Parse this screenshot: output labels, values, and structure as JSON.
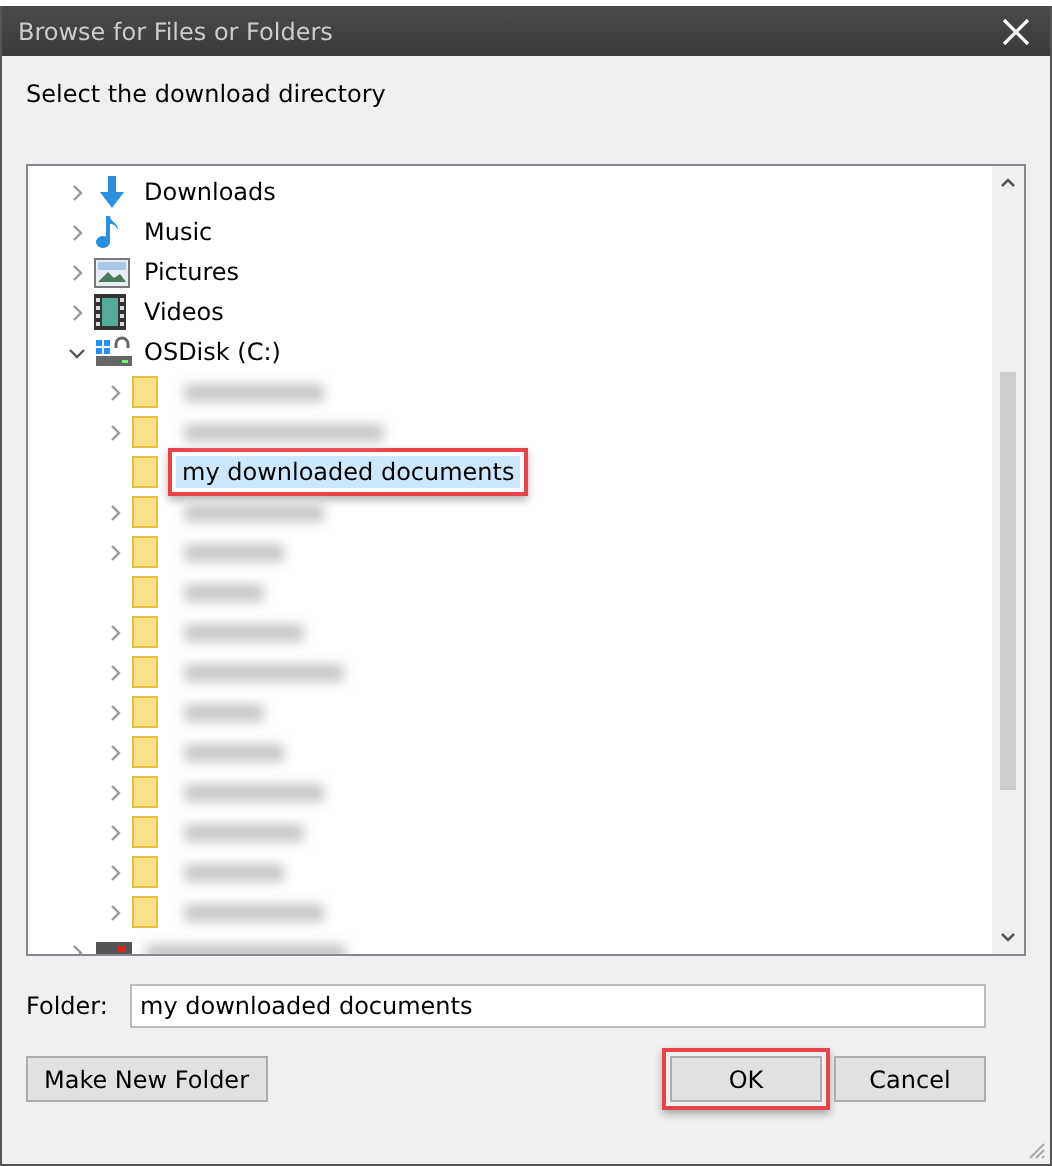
{
  "window": {
    "title": "Browse for Files or Folders"
  },
  "instruction": "Select the download directory",
  "tree": {
    "items": [
      {
        "label": "Downloads",
        "kind": "downloads",
        "expanded": false,
        "blurred": false,
        "selected": false,
        "annotated": false
      },
      {
        "label": "Music",
        "kind": "music",
        "expanded": false,
        "blurred": false,
        "selected": false,
        "annotated": false
      },
      {
        "label": "Pictures",
        "kind": "pictures",
        "expanded": false,
        "blurred": false,
        "selected": false,
        "annotated": false
      },
      {
        "label": "Videos",
        "kind": "videos",
        "expanded": false,
        "blurred": false,
        "selected": false,
        "annotated": false
      },
      {
        "label": "OSDisk (C:)",
        "kind": "drive",
        "expanded": true,
        "blurred": false,
        "selected": false,
        "annotated": false,
        "children": [
          {
            "kind": "folder",
            "expanded": false,
            "blurred": true,
            "selected": false,
            "annotated": false
          },
          {
            "kind": "folder",
            "expanded": false,
            "blurred": true,
            "selected": false,
            "annotated": false
          },
          {
            "label": "my downloaded documents",
            "kind": "folder",
            "blurred": false,
            "selected": true,
            "annotated": true
          },
          {
            "kind": "folder",
            "expanded": false,
            "blurred": true,
            "selected": false,
            "annotated": false
          },
          {
            "kind": "folder",
            "expanded": false,
            "blurred": true,
            "selected": false,
            "annotated": false
          },
          {
            "kind": "folder",
            "blurred": true,
            "selected": false,
            "annotated": false
          },
          {
            "kind": "folder",
            "expanded": false,
            "blurred": true,
            "selected": false,
            "annotated": false
          },
          {
            "kind": "folder",
            "expanded": false,
            "blurred": true,
            "selected": false,
            "annotated": false
          },
          {
            "kind": "folder",
            "expanded": false,
            "blurred": true,
            "selected": false,
            "annotated": false
          },
          {
            "kind": "folder",
            "expanded": false,
            "blurred": true,
            "selected": false,
            "annotated": false
          },
          {
            "kind": "folder",
            "expanded": false,
            "blurred": true,
            "selected": false,
            "annotated": false
          },
          {
            "kind": "folder",
            "expanded": false,
            "blurred": true,
            "selected": false,
            "annotated": false
          },
          {
            "kind": "folder",
            "expanded": false,
            "blurred": true,
            "selected": false,
            "annotated": false
          },
          {
            "kind": "folder",
            "expanded": false,
            "blurred": true,
            "selected": false,
            "annotated": false
          }
        ]
      },
      {
        "kind": "removable",
        "expanded": false,
        "blurred": true,
        "selected": false,
        "annotated": false
      }
    ]
  },
  "folder_field": {
    "label": "Folder:",
    "value": "my downloaded documents"
  },
  "buttons": [
    {
      "label": "Make New Folder",
      "kind": "left",
      "annotated": false
    },
    {
      "label": "OK",
      "kind": "right",
      "annotated": true
    },
    {
      "label": "Cancel",
      "kind": "right",
      "annotated": false
    }
  ]
}
